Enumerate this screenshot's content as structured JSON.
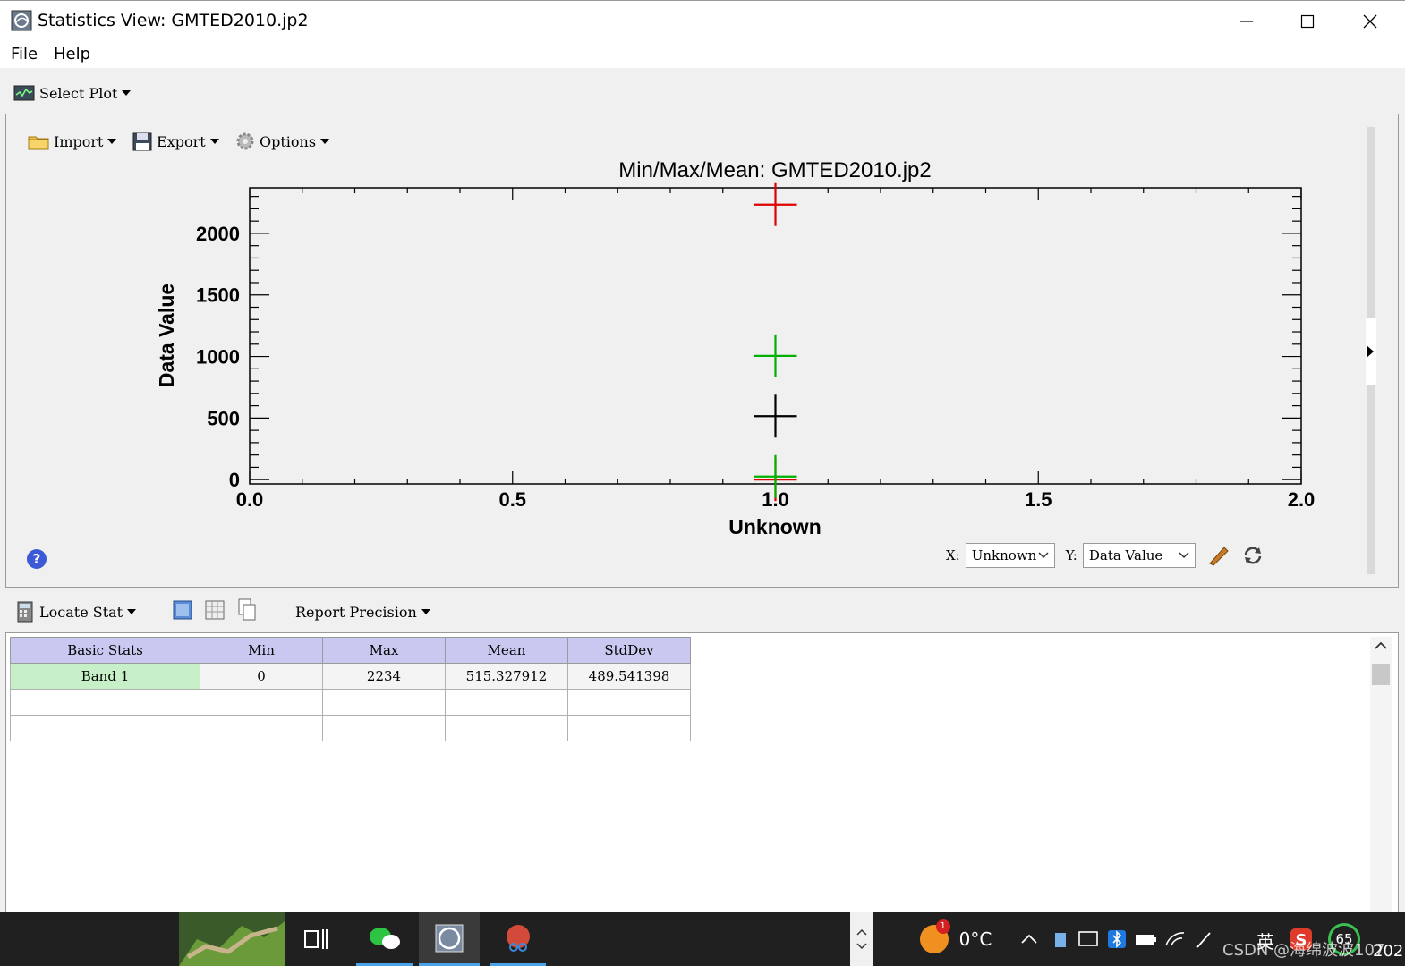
{
  "window": {
    "title": "Statistics View: GMTED2010.jp2"
  },
  "menu": [
    "File",
    "Help"
  ],
  "select_plot": {
    "label": "Select Plot"
  },
  "plot_toolbar": {
    "import": "Import",
    "export": "Export",
    "options": "Options"
  },
  "chart_data": {
    "type": "scatter",
    "title": "Min/Max/Mean: GMTED2010.jp2",
    "xlabel": "Unknown",
    "ylabel": "Data Value",
    "xlim": [
      0.0,
      2.0
    ],
    "ylim": [
      -35,
      2370
    ],
    "xticks": [
      "0.0",
      "0.5",
      "1.0",
      "1.5",
      "2.0"
    ],
    "yticks": [
      "0",
      "500",
      "1000",
      "1500",
      "2000"
    ],
    "series": [
      {
        "color": "#e00000",
        "points": [
          {
            "x": 1.0,
            "y": 2234
          },
          {
            "x": 1.0,
            "y": 0
          }
        ]
      },
      {
        "color": "#00b000",
        "points": [
          {
            "x": 1.0,
            "y": 1005
          },
          {
            "x": 1.0,
            "y": 25
          }
        ]
      },
      {
        "color": "#000000",
        "points": [
          {
            "x": 1.0,
            "y": 515.327912
          }
        ]
      }
    ]
  },
  "axis_select": {
    "x_label": "X:",
    "x_value": "Unknown",
    "y_label": "Y:",
    "y_value": "Data Value"
  },
  "bottom_toolbar": {
    "locate": "Locate Stat",
    "precision": "Report Precision"
  },
  "table": {
    "headers": [
      "Basic Stats",
      "Min",
      "Max",
      "Mean",
      "StdDev"
    ],
    "rows": [
      [
        "Band 1",
        "0",
        "2234",
        "515.327912",
        "489.541398"
      ]
    ]
  },
  "taskbar": {
    "weather": "0°C",
    "badge": "1",
    "ime": "英",
    "battery": "65",
    "clock": "202",
    "watermark": "CSDN @海绵波波107"
  }
}
